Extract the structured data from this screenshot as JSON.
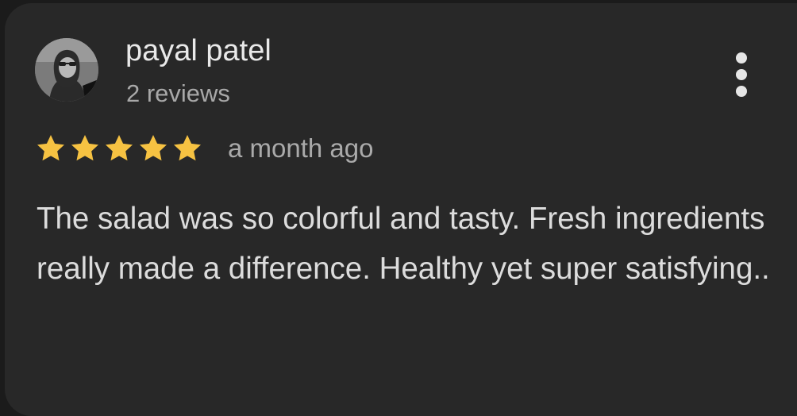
{
  "review": {
    "author": "payal patel",
    "reviews_count": "2 reviews",
    "rating": 5,
    "rating_max": 5,
    "time": "a month ago",
    "text": "The salad was so colorful and tasty. Fresh ingredients really made a difference. Healthy yet super satisfying.."
  },
  "icons": {
    "avatar": "profile-photo",
    "more": "more-vertical-icon",
    "star": "star-icon"
  },
  "colors": {
    "star": "#f6c242",
    "card": "#282828",
    "text": "#dcdcdc"
  }
}
